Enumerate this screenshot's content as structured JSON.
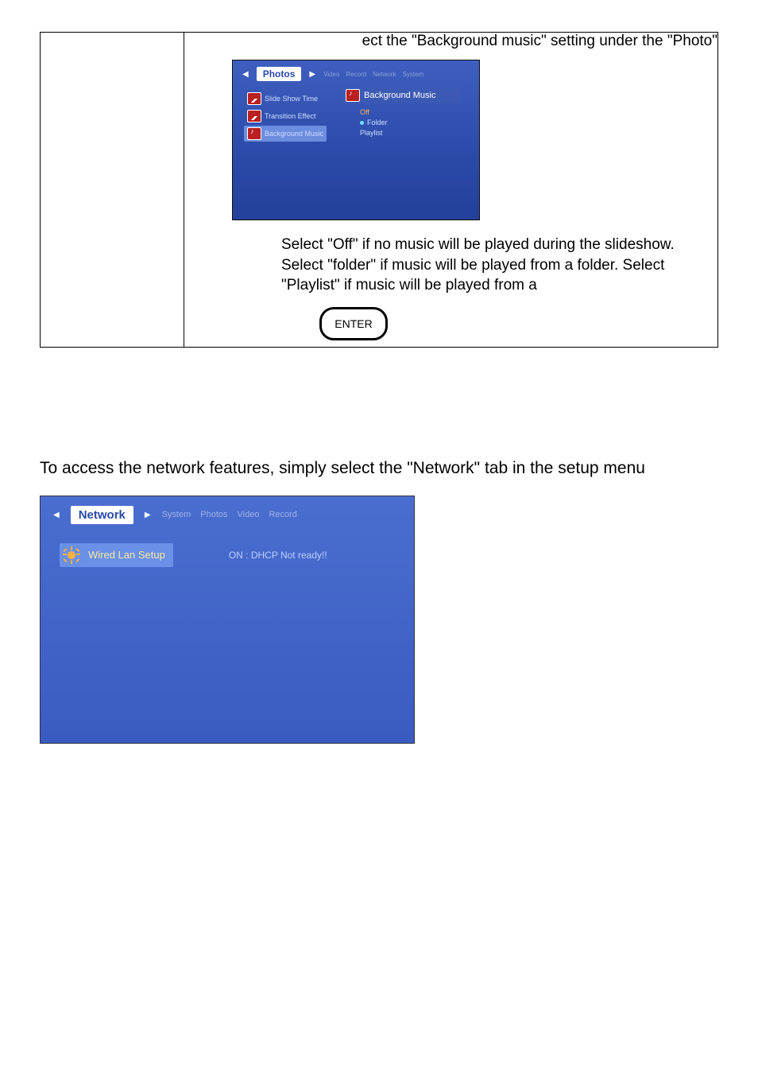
{
  "top": {
    "lead": "ect the \"Background music\" setting under the \"Photo\"",
    "photos_screen": {
      "active_tab": "Photos",
      "inactive_tabs": [
        "Video",
        "Record",
        "Network",
        "System"
      ],
      "side_items": [
        {
          "label": "Slide Show Time"
        },
        {
          "label": "Transition Effect"
        },
        {
          "label": "Background Music"
        }
      ],
      "sub_head": "Background Music",
      "sub_options": [
        {
          "label": "Off",
          "selected": true
        },
        {
          "label": "Folder",
          "selected": false,
          "dotted": true
        },
        {
          "label": "Playlist",
          "selected": false
        }
      ]
    },
    "explain": "Select \"Off\" if no music will be played during the slideshow.    Select \"folder\" if music will be played from a folder.    Select \"Playlist\" if music will be played from a",
    "enter": "ENTER"
  },
  "network": {
    "intro": "To access the network features, simply select the \"Network\" tab in the setup menu",
    "active_tab": "Network",
    "inactive_tabs": [
      "System",
      "Photos",
      "Video",
      "Record"
    ],
    "item_label": "Wired Lan Setup",
    "item_status": "ON : DHCP Not ready!!"
  }
}
